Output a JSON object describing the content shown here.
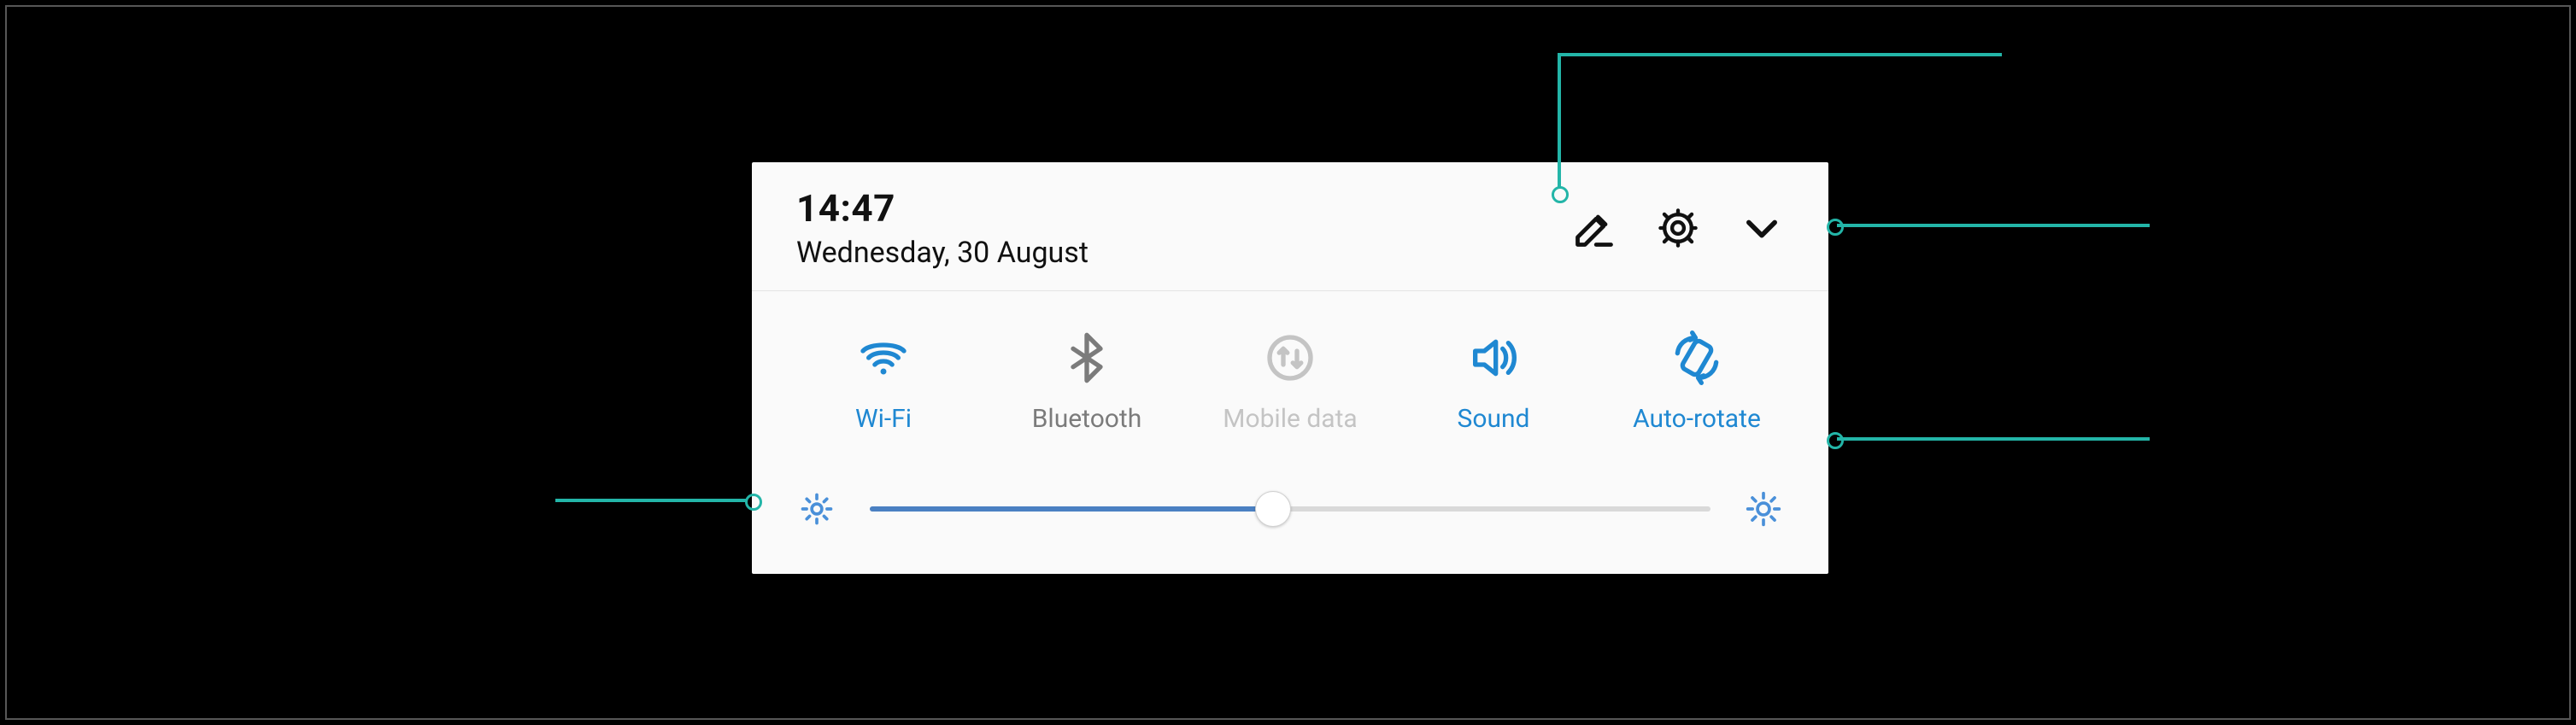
{
  "header": {
    "time": "14:47",
    "date": "Wednesday, 30 August",
    "icons": {
      "edit": "edit-icon",
      "settings": "settings-icon",
      "expand": "chevron-down-icon"
    }
  },
  "tiles": [
    {
      "id": "wifi",
      "label": "Wi-Fi",
      "state": "active"
    },
    {
      "id": "bluetooth",
      "label": "Bluetooth",
      "state": "inactive"
    },
    {
      "id": "mobile-data",
      "label": "Mobile data",
      "state": "disabled"
    },
    {
      "id": "sound",
      "label": "Sound",
      "state": "active"
    },
    {
      "id": "auto-rotate",
      "label": "Auto-rotate",
      "state": "active"
    }
  ],
  "brightness": {
    "percent": 48
  },
  "colors": {
    "accent": "#1f88d2",
    "slider_fill": "#4a80c2",
    "callout": "#23b5a8"
  }
}
